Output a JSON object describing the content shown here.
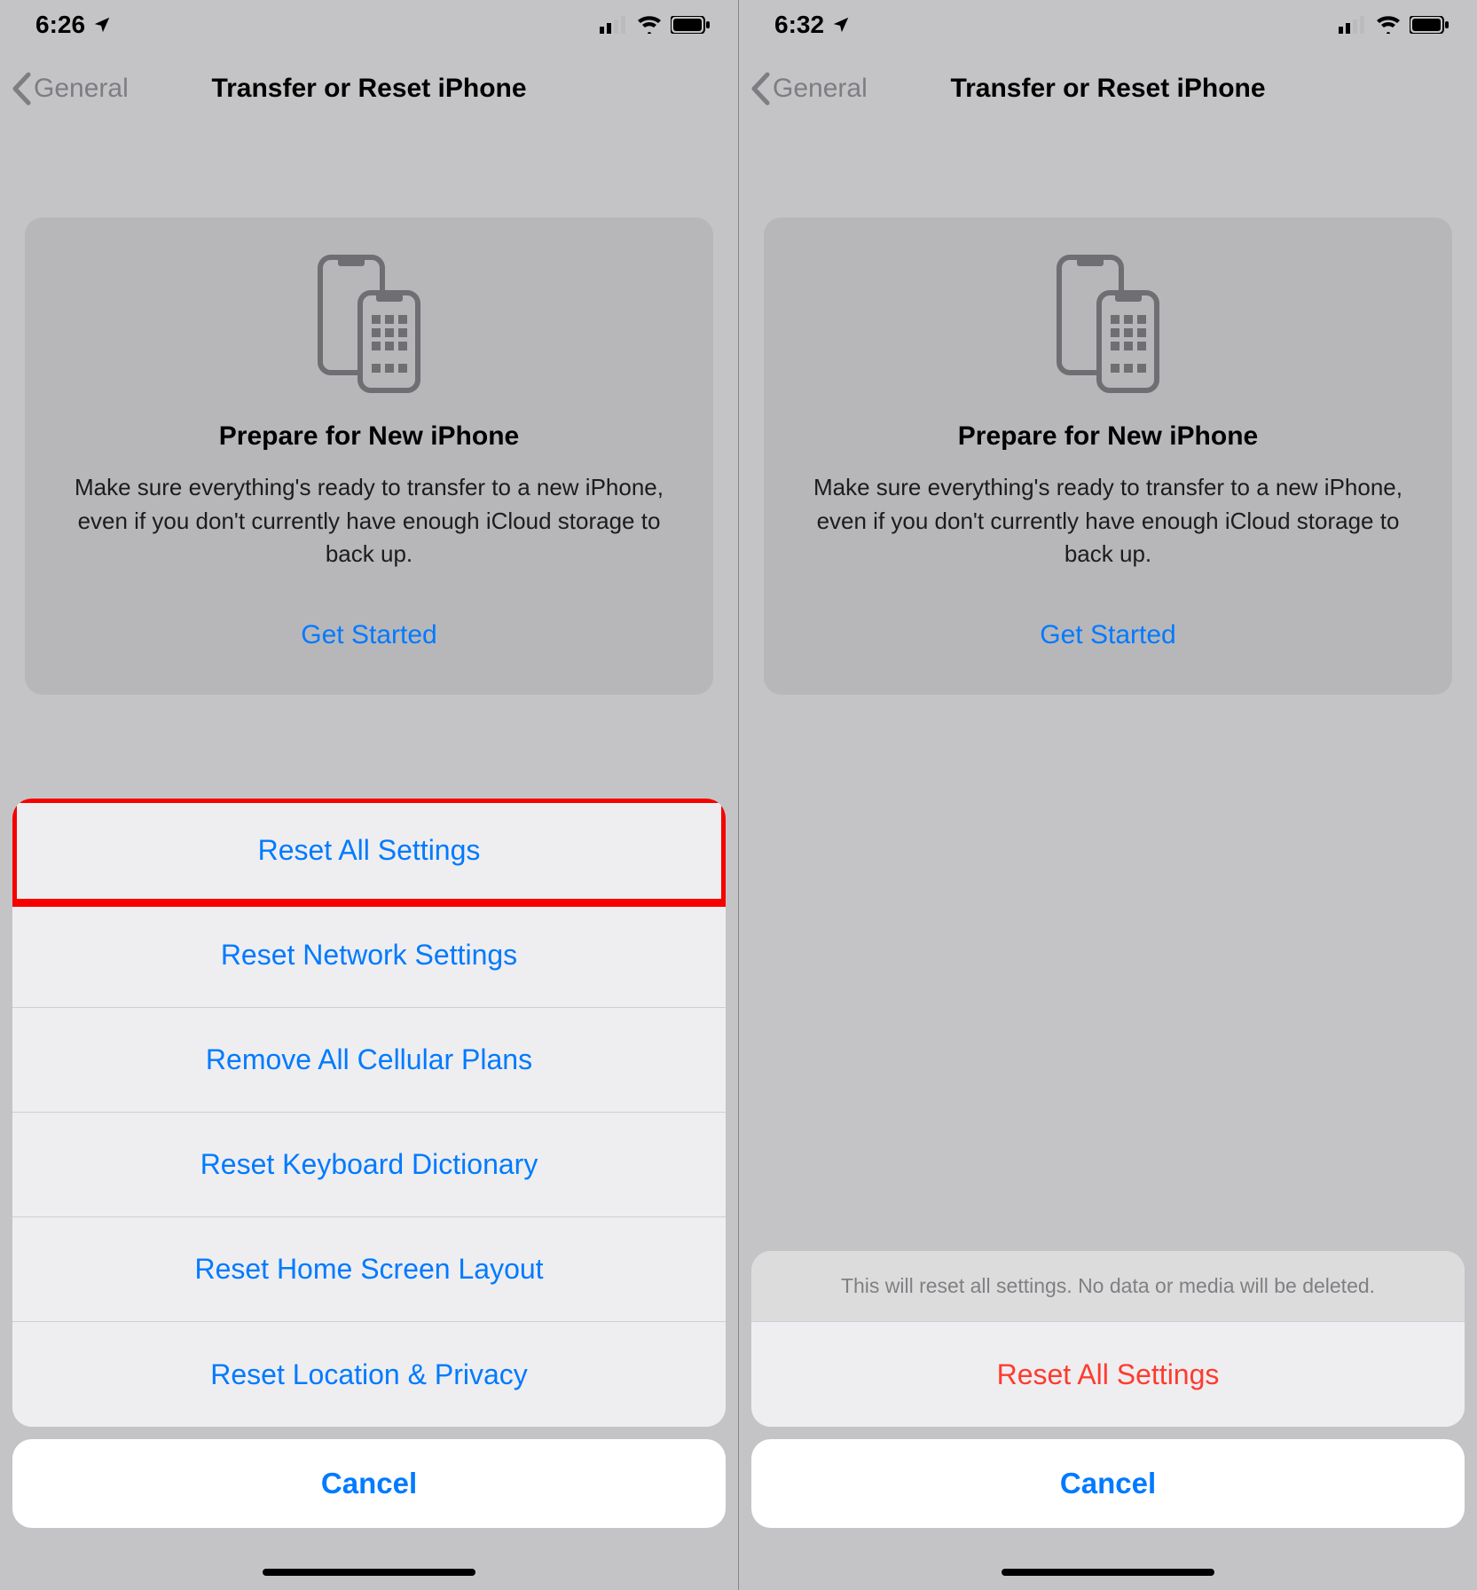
{
  "colors": {
    "accent": "#007aff",
    "destructive": "#ff3b30",
    "highlight_border": "#f60000"
  },
  "left": {
    "status": {
      "time": "6:26"
    },
    "nav": {
      "back": "General",
      "title": "Transfer or Reset iPhone"
    },
    "card": {
      "title": "Prepare for New iPhone",
      "desc": "Make sure everything's ready to transfer to a new iPhone, even if you don't currently have enough iCloud storage to back up.",
      "link": "Get Started"
    },
    "sheet": {
      "items": [
        "Reset All Settings",
        "Reset Network Settings",
        "Remove All Cellular Plans",
        "Reset Keyboard Dictionary",
        "Reset Home Screen Layout",
        "Reset Location & Privacy"
      ],
      "cancel": "Cancel"
    }
  },
  "right": {
    "status": {
      "time": "6:32"
    },
    "nav": {
      "back": "General",
      "title": "Transfer or Reset iPhone"
    },
    "card": {
      "title": "Prepare for New iPhone",
      "desc": "Make sure everything's ready to transfer to a new iPhone, even if you don't currently have enough iCloud storage to back up.",
      "link": "Get Started"
    },
    "sheet": {
      "message": "This will reset all settings. No data or media will be deleted.",
      "action": "Reset All Settings",
      "cancel": "Cancel"
    }
  }
}
